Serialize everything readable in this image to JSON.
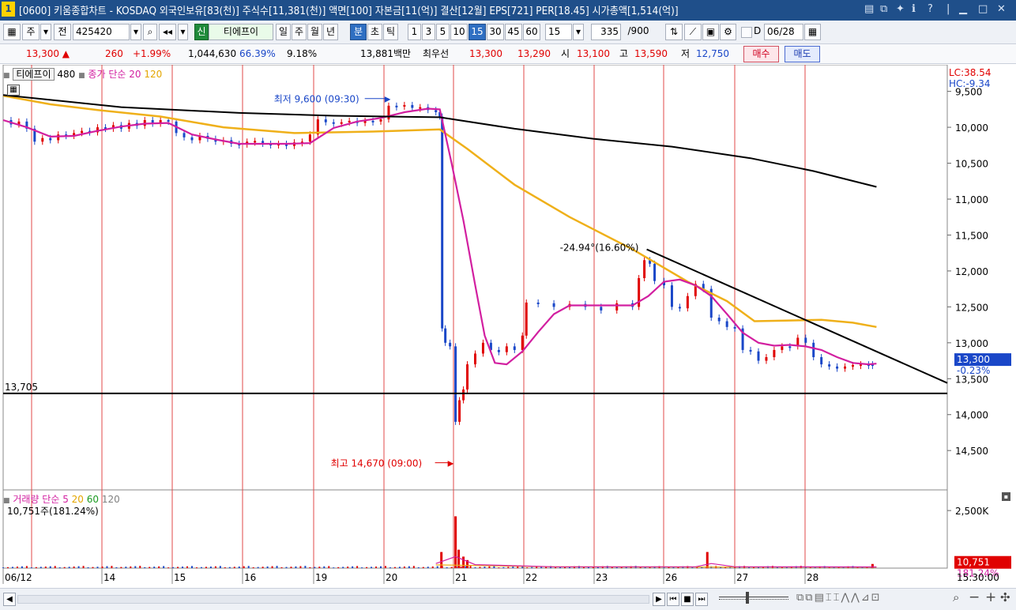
{
  "window": {
    "number": "1",
    "title": "[0600] 키움종합차트 - KOSDAQ 외국인보유[83(천)] 주식수[11,381(천)] 액면[100] 자본금[11(억)] 결산[12월] EPS[721] PER[18.45] 시가총액[1,514(억)]",
    "icons": [
      "grid-icon",
      "copy-icon",
      "pin-icon",
      "info-icon",
      "help-icon",
      "minimize-icon",
      "maximize-icon",
      "close-icon"
    ]
  },
  "toolbar": {
    "period_label": "주",
    "prev_label": "전",
    "code": "425420",
    "stock_badge": "신",
    "stock_name": "티에프이",
    "period_tabs": [
      "일",
      "주",
      "월",
      "년",
      "분",
      "초",
      "틱"
    ],
    "active_tab": "분",
    "intervals": [
      "1",
      "3",
      "5",
      "10",
      "15",
      "30",
      "45",
      "60"
    ],
    "active_interval": "15",
    "interval_select": "15",
    "count": "335",
    "count_total": "/900",
    "date": "06/28"
  },
  "info": {
    "price": "13,300 ▲",
    "change": "260",
    "change_pct": "+1.99%",
    "volume": "1,044,630",
    "vol_ratio": "66.39%",
    "turnover": "9.18%",
    "amount": "13,881백만",
    "best_label": "최우선",
    "ask": "13,300",
    "bid": "13,290",
    "open_label": "시",
    "open": "13,100",
    "high_label": "고",
    "high": "13,590",
    "low_label": "저",
    "low": "12,750",
    "buy_label": "매수",
    "sell_label": "매도"
  },
  "price_legend": {
    "name": "티에프이",
    "ma1": "480",
    "close_label": "종가 단순",
    "ma2": "20",
    "ma3": "120"
  },
  "lc_label": "LC:38.54",
  "hc_label": "HC:-9.34",
  "volume_legend": {
    "label": "거래량 단순",
    "periods": [
      "5",
      "20",
      "60",
      "120"
    ],
    "current": "10,751주(181.24%)"
  },
  "annotations": {
    "min_label": "최저 9,600 (09:30)",
    "max_label": "최고 14,670 (09:00)",
    "trend_label": "-24.94°(16.60%)",
    "hline_label": "13,705"
  },
  "price_box": {
    "value": "13,300",
    "pct": "-0.23%"
  },
  "vol_box": {
    "value": "10,751",
    "pct": "181.24%"
  },
  "bottom": {
    "time": "15:30:00"
  },
  "colors": {
    "up": "#e00000",
    "down": "#1a47c8",
    "ma20": "#d21fa0",
    "ma120": "#efb01a",
    "trend": "#000000"
  },
  "chart_data": {
    "type": "candlestick",
    "y_axis_inverted": true,
    "ylim": [
      9350,
      14850
    ],
    "y_ticks": [
      "9,500",
      "10,000",
      "10,500",
      "11,000",
      "11,500",
      "12,000",
      "12,500",
      "13,000",
      "13,500",
      "14,000",
      "14,500"
    ],
    "y_tick_values": [
      9500,
      10000,
      10500,
      11000,
      11500,
      12000,
      12500,
      13000,
      13500,
      14000,
      14500
    ],
    "x_labels": [
      "06/12",
      "14",
      "15",
      "16",
      "19",
      "20",
      "21",
      "22",
      "23",
      "26",
      "27",
      "28"
    ],
    "day_separators": [
      12,
      13,
      14,
      15,
      16,
      19,
      20,
      21,
      22,
      23,
      26,
      27,
      28
    ],
    "vol_ticks": [
      "2,500K"
    ],
    "vol_tick_values": [
      2500000
    ],
    "vol_max": 3500000,
    "ma120": [
      [
        0,
        9560
      ],
      [
        60,
        9680
      ],
      [
        120,
        9760
      ],
      [
        200,
        9850
      ],
      [
        280,
        10000
      ],
      [
        370,
        10080
      ],
      [
        470,
        10060
      ],
      [
        555,
        10030
      ],
      [
        590,
        10300
      ],
      [
        650,
        10800
      ],
      [
        720,
        11250
      ],
      [
        800,
        11700
      ],
      [
        870,
        12150
      ],
      [
        920,
        12420
      ],
      [
        955,
        12700
      ],
      [
        1000,
        12690
      ],
      [
        1040,
        12680
      ],
      [
        1080,
        12720
      ],
      [
        1110,
        12780
      ]
    ],
    "ma480": [
      [
        0,
        9550
      ],
      [
        150,
        9720
      ],
      [
        300,
        9800
      ],
      [
        420,
        9840
      ],
      [
        555,
        9860
      ],
      [
        650,
        10020
      ],
      [
        750,
        10160
      ],
      [
        850,
        10270
      ],
      [
        950,
        10430
      ],
      [
        1030,
        10610
      ],
      [
        1110,
        10830
      ]
    ],
    "closes": [
      [
        0,
        9900
      ],
      [
        10,
        9960
      ],
      [
        20,
        9920
      ],
      [
        30,
        10020
      ],
      [
        40,
        10200
      ],
      [
        50,
        10150
      ],
      [
        60,
        10180
      ],
      [
        70,
        10100
      ],
      [
        80,
        10120
      ],
      [
        90,
        10080
      ],
      [
        100,
        10050
      ],
      [
        110,
        10070
      ],
      [
        120,
        10000
      ],
      [
        130,
        10020
      ],
      [
        140,
        9970
      ],
      [
        150,
        10020
      ],
      [
        160,
        9940
      ],
      [
        170,
        9980
      ],
      [
        180,
        9900
      ],
      [
        190,
        9950
      ],
      [
        200,
        9900
      ],
      [
        210,
        9920
      ],
      [
        220,
        10080
      ],
      [
        230,
        10140
      ],
      [
        240,
        10180
      ],
      [
        250,
        10120
      ],
      [
        260,
        10160
      ],
      [
        270,
        10200
      ],
      [
        280,
        10180
      ],
      [
        290,
        10230
      ],
      [
        300,
        10240
      ],
      [
        310,
        10200
      ],
      [
        320,
        10190
      ],
      [
        330,
        10230
      ],
      [
        340,
        10240
      ],
      [
        350,
        10230
      ],
      [
        360,
        10260
      ],
      [
        370,
        10210
      ],
      [
        380,
        10200
      ],
      [
        390,
        10100
      ],
      [
        400,
        9890
      ],
      [
        410,
        9930
      ],
      [
        420,
        9940
      ],
      [
        430,
        9930
      ],
      [
        440,
        9910
      ],
      [
        450,
        9940
      ],
      [
        460,
        9910
      ],
      [
        470,
        9920
      ],
      [
        480,
        9890
      ],
      [
        490,
        9700
      ],
      [
        500,
        9700
      ],
      [
        510,
        9690
      ],
      [
        520,
        9730
      ],
      [
        530,
        9720
      ],
      [
        540,
        9760
      ],
      [
        550,
        9790
      ],
      [
        555,
        9850
      ],
      [
        558,
        12800
      ],
      [
        562,
        13000
      ],
      [
        568,
        13050
      ],
      [
        575,
        14100
      ],
      [
        580,
        13800
      ],
      [
        585,
        13650
      ],
      [
        590,
        13300
      ],
      [
        600,
        13150
      ],
      [
        610,
        13000
      ],
      [
        620,
        13100
      ],
      [
        630,
        13130
      ],
      [
        640,
        13050
      ],
      [
        650,
        13100
      ],
      [
        660,
        12900
      ],
      [
        665,
        12440
      ],
      [
        680,
        12450
      ],
      [
        700,
        12500
      ],
      [
        720,
        12460
      ],
      [
        740,
        12500
      ],
      [
        760,
        12550
      ],
      [
        780,
        12450
      ],
      [
        800,
        12500
      ],
      [
        808,
        12100
      ],
      [
        815,
        11850
      ],
      [
        822,
        11900
      ],
      [
        828,
        12140
      ],
      [
        840,
        12200
      ],
      [
        850,
        12500
      ],
      [
        860,
        12520
      ],
      [
        870,
        12350
      ],
      [
        880,
        12180
      ],
      [
        890,
        12250
      ],
      [
        900,
        12650
      ],
      [
        910,
        12700
      ],
      [
        920,
        12780
      ],
      [
        930,
        12800
      ],
      [
        940,
        13100
      ],
      [
        950,
        13120
      ],
      [
        960,
        13250
      ],
      [
        970,
        13200
      ],
      [
        980,
        13100
      ],
      [
        990,
        13050
      ],
      [
        1000,
        13050
      ],
      [
        1010,
        12930
      ],
      [
        1020,
        13000
      ],
      [
        1030,
        13200
      ],
      [
        1040,
        13300
      ],
      [
        1050,
        13330
      ],
      [
        1060,
        13360
      ],
      [
        1070,
        13330
      ],
      [
        1080,
        13310
      ],
      [
        1090,
        13300
      ],
      [
        1100,
        13300
      ],
      [
        1105,
        13300
      ]
    ],
    "ma20": [
      [
        0,
        9900
      ],
      [
        30,
        10000
      ],
      [
        60,
        10130
      ],
      [
        90,
        10120
      ],
      [
        120,
        10050
      ],
      [
        150,
        9990
      ],
      [
        180,
        9950
      ],
      [
        210,
        9940
      ],
      [
        240,
        10100
      ],
      [
        270,
        10170
      ],
      [
        300,
        10230
      ],
      [
        330,
        10230
      ],
      [
        360,
        10230
      ],
      [
        390,
        10220
      ],
      [
        420,
        10010
      ],
      [
        450,
        9920
      ],
      [
        480,
        9870
      ],
      [
        510,
        9790
      ],
      [
        540,
        9740
      ],
      [
        555,
        9750
      ],
      [
        570,
        10500
      ],
      [
        585,
        11300
      ],
      [
        600,
        12200
      ],
      [
        612,
        12900
      ],
      [
        625,
        13280
      ],
      [
        640,
        13300
      ],
      [
        660,
        13120
      ],
      [
        680,
        12850
      ],
      [
        700,
        12600
      ],
      [
        720,
        12480
      ],
      [
        760,
        12480
      ],
      [
        800,
        12480
      ],
      [
        820,
        12350
      ],
      [
        840,
        12150
      ],
      [
        860,
        12120
      ],
      [
        880,
        12200
      ],
      [
        900,
        12350
      ],
      [
        920,
        12600
      ],
      [
        940,
        12860
      ],
      [
        960,
        13000
      ],
      [
        980,
        13040
      ],
      [
        1000,
        13030
      ],
      [
        1020,
        13050
      ],
      [
        1040,
        13100
      ],
      [
        1060,
        13200
      ],
      [
        1080,
        13280
      ],
      [
        1100,
        13300
      ],
      [
        1110,
        13290
      ]
    ],
    "trend1": [
      [
        0,
        9530
      ],
      [
        555,
        9780
      ],
      [
        1110,
        10830
      ]
    ],
    "trend2": [
      [
        818,
        11700
      ],
      [
        1200,
        13560
      ]
    ],
    "hline": 13705,
    "volume_spikes": [
      [
        557,
        700000
      ],
      [
        575,
        2250000
      ],
      [
        579,
        800000
      ],
      [
        585,
        500000
      ],
      [
        590,
        350000
      ],
      [
        895,
        700000
      ],
      [
        1105,
        180000
      ]
    ],
    "current_price": 13300,
    "day_high_price": 14670,
    "day_low_price": 9600
  }
}
